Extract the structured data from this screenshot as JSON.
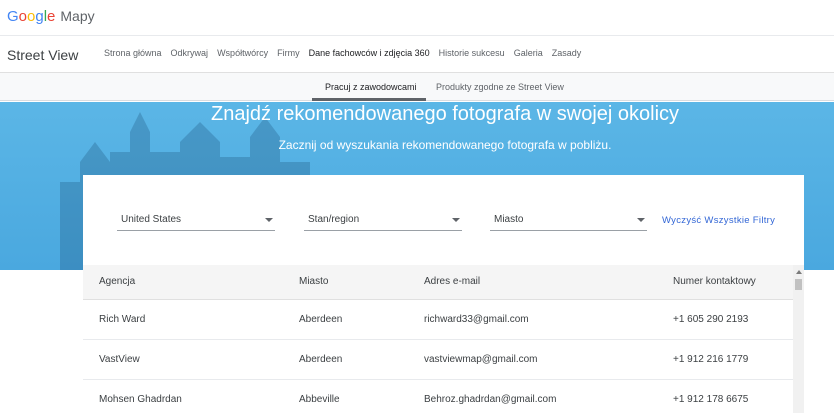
{
  "header": {
    "logo_letters": [
      {
        "char": "G",
        "color": "#4285F4"
      },
      {
        "char": "o",
        "color": "#EA4335"
      },
      {
        "char": "o",
        "color": "#FBBC05"
      },
      {
        "char": "g",
        "color": "#4285F4"
      },
      {
        "char": "l",
        "color": "#34A853"
      },
      {
        "char": "e",
        "color": "#EA4335"
      }
    ],
    "product": "Mapy"
  },
  "nav": {
    "brand": "Street View",
    "items": [
      {
        "label": "Strona główna",
        "active": false
      },
      {
        "label": "Odkrywaj",
        "active": false
      },
      {
        "label": "Współtwórcy",
        "active": false
      },
      {
        "label": "Firmy",
        "active": false
      },
      {
        "label": "Dane fachowców i zdjęcia 360",
        "active": true
      },
      {
        "label": "Historie sukcesu",
        "active": false
      },
      {
        "label": "Galeria",
        "active": false
      },
      {
        "label": "Zasady",
        "active": false
      }
    ]
  },
  "subnav": {
    "tabs": [
      {
        "label": "Pracuj z zawodowcami",
        "active": true
      },
      {
        "label": "Produkty zgodne ze Street View",
        "active": false
      }
    ]
  },
  "hero": {
    "title": "Znajdź rekomendowanego fotografa w swojej okolicy",
    "subtitle": "Zacznij od wyszukania rekomendowanego fotografa w pobliżu."
  },
  "filters": {
    "country": "United States",
    "region": "Stan/region",
    "city": "Miasto",
    "clear_label": "Wyczyść Wszystkie Filtry"
  },
  "table": {
    "headers": [
      "Agencja",
      "Miasto",
      "Adres e-mail",
      "Numer kontaktowy"
    ],
    "rows": [
      [
        "Rich Ward",
        "Aberdeen",
        "richward33@gmail.com",
        "+1 605 290 2193"
      ],
      [
        "VastView",
        "Aberdeen",
        "vastviewmap@gmail.com",
        "+1 912 216 1779"
      ],
      [
        "Mohsen Ghadrdan",
        "Abbeville",
        "Behroz.ghadrdan@gmail.com",
        "+1 912 178 6675"
      ]
    ]
  },
  "colors": {
    "hero_blue": "#4aa8df",
    "link_blue": "#3367d6"
  }
}
